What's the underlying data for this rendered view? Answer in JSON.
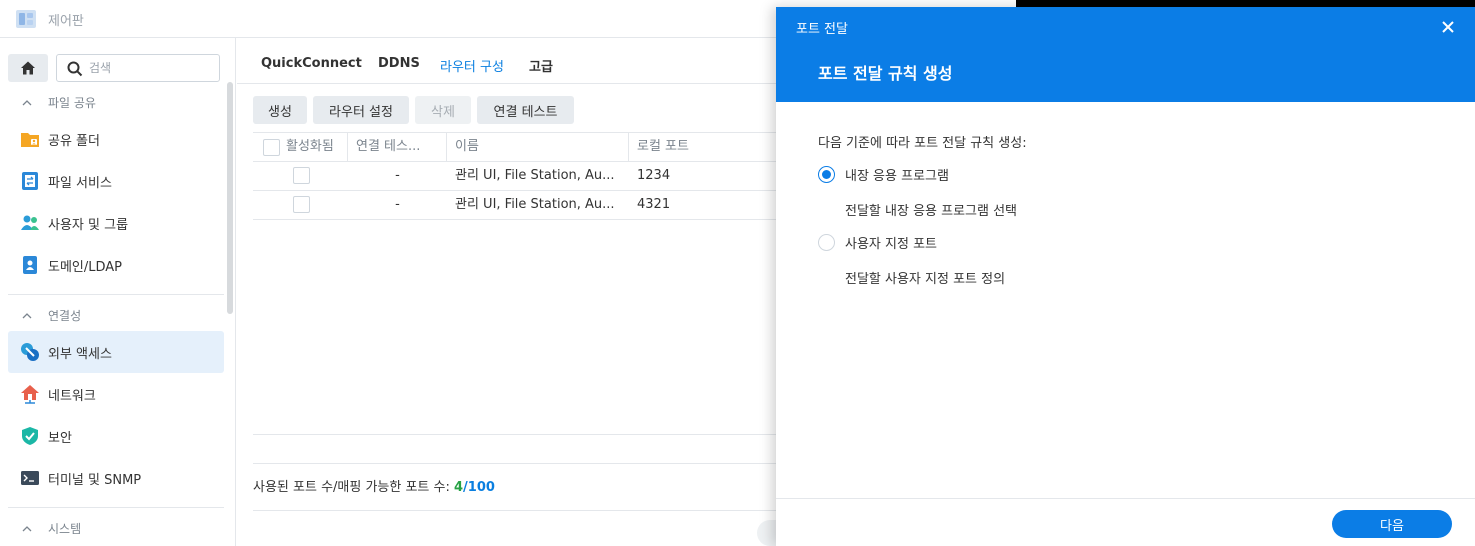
{
  "app": {
    "title": "제어판"
  },
  "sidebar": {
    "search_placeholder": "검색",
    "sections": [
      {
        "label": "파일 공유",
        "items": [
          {
            "label": "공유 폴더",
            "icon": "shared-folder-icon"
          },
          {
            "label": "파일 서비스",
            "icon": "file-services-icon"
          },
          {
            "label": "사용자 및 그룹",
            "icon": "users-groups-icon"
          },
          {
            "label": "도메인/LDAP",
            "icon": "domain-ldap-icon"
          }
        ]
      },
      {
        "label": "연결성",
        "items": [
          {
            "label": "외부 액세스",
            "icon": "external-access-icon",
            "active": true
          },
          {
            "label": "네트워크",
            "icon": "network-icon"
          },
          {
            "label": "보안",
            "icon": "security-shield-icon"
          },
          {
            "label": "터미널 및 SNMP",
            "icon": "terminal-icon"
          }
        ]
      },
      {
        "label": "시스템",
        "items": []
      }
    ]
  },
  "main": {
    "tabs": [
      {
        "label": "QuickConnect"
      },
      {
        "label": "DDNS"
      },
      {
        "label": "라우터 구성",
        "active": true
      },
      {
        "label": "고급"
      }
    ],
    "toolbar": {
      "create": "생성",
      "router_settings": "라우터 설정",
      "delete": "삭제",
      "test_connection": "연결 테스트"
    },
    "columns": [
      "활성화됨",
      "연결 테스...",
      "이름",
      "로컬 포트"
    ],
    "rows": [
      {
        "enabled": false,
        "test": "-",
        "name": "관리 UI, File Station, Au...",
        "local_port": "1234"
      },
      {
        "enabled": false,
        "test": "-",
        "name": "관리 UI, File Station, Au...",
        "local_port": "4321"
      }
    ],
    "footer": {
      "label": "사용된 포트 수/매핑 가능한 포트 수: ",
      "used": "4",
      "separator": "/",
      "total": "100"
    }
  },
  "dialog": {
    "title": "포트 전달",
    "subtitle": "포트 전달 규칙 생성",
    "prompt": "다음 기준에 따라 포트 전달 규칙 생성:",
    "options": [
      {
        "label": "내장 응용 프로그램",
        "desc": "전달할 내장 응용 프로그램 선택",
        "checked": true
      },
      {
        "label": "사용자 지정 포트",
        "desc": "전달할 사용자 지정 포트 정의",
        "checked": false
      }
    ],
    "next_label": "다음"
  },
  "colors": {
    "accent": "#0b7de6",
    "used": "#27a245",
    "active_bg": "#e5f0fb"
  }
}
